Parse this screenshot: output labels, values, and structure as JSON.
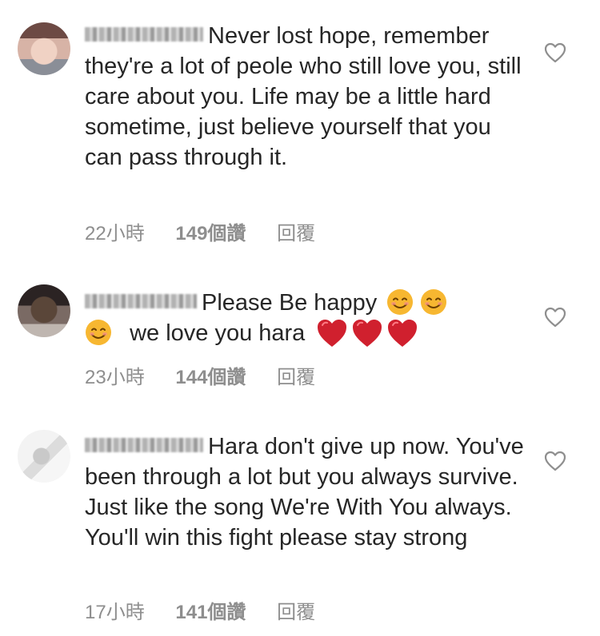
{
  "comments": [
    {
      "text": "Never lost hope, remember they're a lot of peole who still love you, still care about you. Life may be a little hard sometime, just believe yourself that you can pass through it.",
      "time": "22小時",
      "likes": "149個讚",
      "reply": "回覆"
    },
    {
      "text_part1": "Please Be happy",
      "text_part2": "we love you hara",
      "emoji_smile": "smiling-face-emoji",
      "emoji_heart": "red-heart-emoji",
      "time": "23小時",
      "likes": "144個讚",
      "reply": "回覆"
    },
    {
      "text": "Hara don't give up now. You've been through a lot but you always survive. Just like the song We're With You always. You'll win this fight please stay strong",
      "time": "17小時",
      "likes": "141個讚",
      "reply": "回覆"
    }
  ],
  "colors": {
    "text": "#262626",
    "meta": "#8e8e8e",
    "heart_outline": "#8e8e8e",
    "emoji_heart": "#d0202e",
    "emoji_smile": "#f7b731"
  },
  "icons": {
    "like": "heart-outline-icon"
  }
}
